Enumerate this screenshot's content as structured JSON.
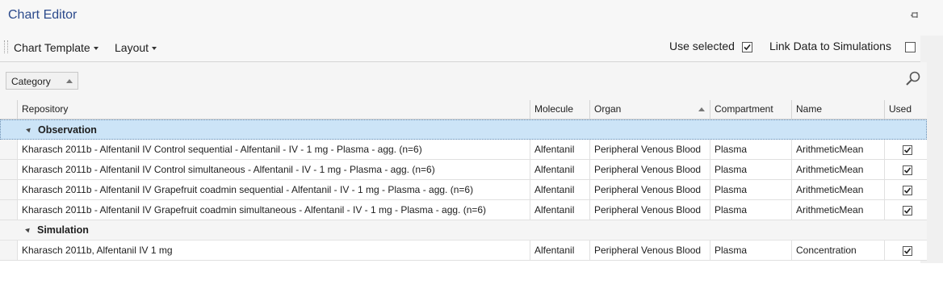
{
  "window": {
    "title": "Chart Editor"
  },
  "toolbar": {
    "chart_template_label": "Chart Template",
    "layout_label": "Layout",
    "use_selected_label": "Use selected",
    "use_selected_checked": true,
    "link_data_label": "Link Data to Simulations",
    "link_data_checked": false
  },
  "group_panel": {
    "chip_label": "Category",
    "chip_sort": "ascending"
  },
  "grid": {
    "columns": {
      "repository": "Repository",
      "molecule": "Molecule",
      "organ": "Organ",
      "compartment": "Compartment",
      "name": "Name",
      "used": "Used"
    },
    "sorted_column": "Organ",
    "groups": [
      {
        "label": "Observation",
        "selected": true,
        "rows": [
          {
            "repository": "Kharasch 2011b - Alfentanil IV Control sequential - Alfentanil - IV - 1 mg - Plasma - agg. (n=6)",
            "molecule": "Alfentanil",
            "organ": "Peripheral Venous Blood",
            "compartment": "Plasma",
            "name": "ArithmeticMean",
            "used": true
          },
          {
            "repository": "Kharasch 2011b - Alfentanil IV Control simultaneous - Alfentanil - IV - 1 mg - Plasma - agg. (n=6)",
            "molecule": "Alfentanil",
            "organ": "Peripheral Venous Blood",
            "compartment": "Plasma",
            "name": "ArithmeticMean",
            "used": true
          },
          {
            "repository": "Kharasch 2011b - Alfentanil IV Grapefruit coadmin sequential - Alfentanil - IV - 1 mg - Plasma - agg. (n=6)",
            "molecule": "Alfentanil",
            "organ": "Peripheral Venous Blood",
            "compartment": "Plasma",
            "name": "ArithmeticMean",
            "used": true
          },
          {
            "repository": "Kharasch 2011b - Alfentanil IV Grapefruit coadmin simultaneous - Alfentanil - IV - 1 mg - Plasma - agg. (n=6)",
            "molecule": "Alfentanil",
            "organ": "Peripheral Venous Blood",
            "compartment": "Plasma",
            "name": "ArithmeticMean",
            "used": true
          }
        ]
      },
      {
        "label": "Simulation",
        "selected": false,
        "rows": [
          {
            "repository": "Kharasch 2011b, Alfentanil IV 1 mg",
            "molecule": "Alfentanil",
            "organ": "Peripheral Venous Blood",
            "compartment": "Plasma",
            "name": "Concentration",
            "used": true
          }
        ]
      }
    ]
  },
  "colors": {
    "title": "#2b4a8c",
    "selection": "#cce4f7",
    "header_bg": "#f5f5f5"
  },
  "icons": {
    "pin": "pin-icon",
    "search": "search-icon",
    "dropdown": "chevron-down-icon",
    "check": "checkmark-icon"
  }
}
